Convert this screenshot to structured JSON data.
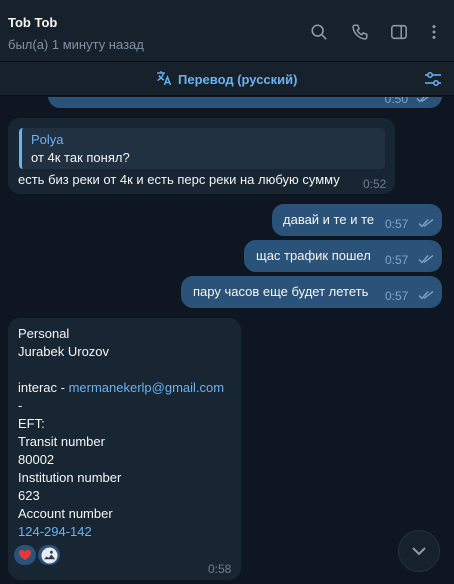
{
  "header": {
    "name": "Tob Tob",
    "status": "был(а) 1 минуту назад",
    "icons": [
      "search-icon",
      "phone-icon",
      "sidebar-icon",
      "more-icon"
    ]
  },
  "translate": {
    "label": "Перевод (русский)",
    "icon": "translate-icon",
    "settings_icon": "filter-settings-icon"
  },
  "messages": {
    "partial": {
      "time": "0:50"
    },
    "reply_msg": {
      "reply_name": "Polya",
      "reply_text": "от 4к так понял?",
      "text": "есть биз реки от 4к и есть перс реки на любую сумму",
      "time": "0:52"
    },
    "out1": {
      "text": "давай и те и те",
      "time": "0:57"
    },
    "out2": {
      "text": "щас трафик пошел",
      "time": "0:57"
    },
    "out3": {
      "text": "пару часов еще будет лететь",
      "time": "0:57"
    },
    "info": {
      "l1": "Personal",
      "l2": "Jurabek Urozov",
      "l3_prefix": "interac - ",
      "l3_link": "mermanekerlp@gmail.com",
      "l4": "-",
      "l5": "EFT:",
      "l6": "Transit number",
      "l7": "80002",
      "l8": "Institution number",
      "l9": "623",
      "l10": "Account number",
      "l11": "124-294-142",
      "time": "0:58",
      "reactions": [
        "heart-reaction",
        "avatar-reaction"
      ]
    }
  },
  "colors": {
    "background": "#0e1621",
    "header": "#17212b",
    "incoming": "#182533",
    "outgoing": "#2b5278",
    "accent": "#6ab3f3"
  }
}
